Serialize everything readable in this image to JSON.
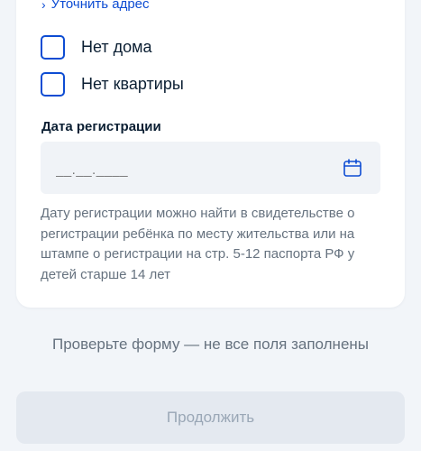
{
  "address": {
    "refine_link_label": "Уточнить адрес"
  },
  "checkboxes": [
    {
      "label": "Нет дома",
      "checked": false
    },
    {
      "label": "Нет квартиры",
      "checked": false
    }
  ],
  "registration_date": {
    "label": "Дата регистрации",
    "placeholder": "__.__.____",
    "hint": "Дату регистрации можно найти в свидетельстве о регистрации ребёнка по месту жительства или на штампе о регистрации на стр. 5-12 паспорта РФ у детей старше 14 лет"
  },
  "form_warning": "Проверьте форму — не все поля заполнены",
  "continue_button_label": "Продолжить",
  "icons": {
    "refine": "chevron-right-icon",
    "calendar": "calendar-icon"
  },
  "colors": {
    "accent": "#0d4cd3",
    "text_primary": "#0b1f33",
    "text_secondary": "#66727f",
    "field_background": "#f0f3f7",
    "page_background": "#f2f5f9",
    "button_disabled_background": "#e4e9f0",
    "button_disabled_text": "#9aa7b6"
  }
}
